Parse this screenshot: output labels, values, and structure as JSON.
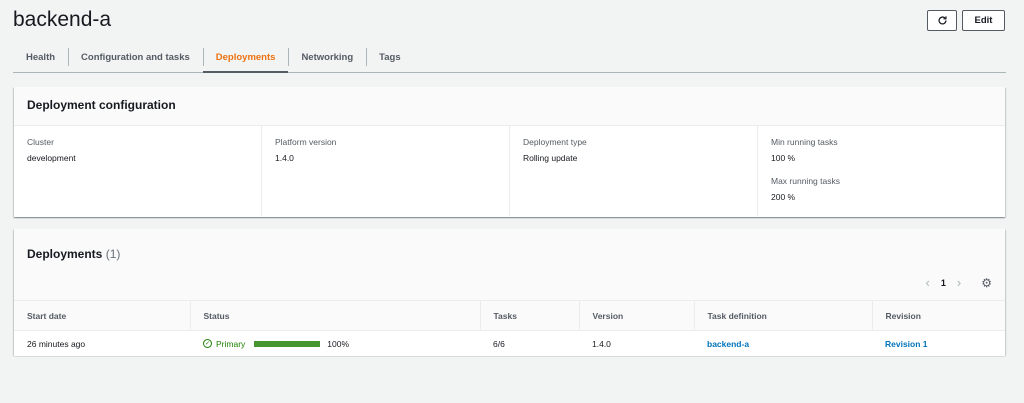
{
  "page": {
    "title": "backend-a",
    "edit_label": "Edit",
    "refresh_icon": "refresh-icon"
  },
  "tabs": [
    {
      "label": "Health",
      "active": false
    },
    {
      "label": "Configuration and tasks",
      "active": false
    },
    {
      "label": "Deployments",
      "active": true
    },
    {
      "label": "Networking",
      "active": false
    },
    {
      "label": "Tags",
      "active": false
    }
  ],
  "deployment_config": {
    "title": "Deployment configuration",
    "cluster": {
      "label": "Cluster",
      "value": "development"
    },
    "platform_version": {
      "label": "Platform version",
      "value": "1.4.0"
    },
    "deployment_type": {
      "label": "Deployment type",
      "value": "Rolling update"
    },
    "min_running": {
      "label": "Min running tasks",
      "value": "100 %"
    },
    "max_running": {
      "label": "Max running tasks",
      "value": "200 %"
    }
  },
  "deployments": {
    "title": "Deployments",
    "count": "(1)",
    "pager": {
      "current_page": "1"
    },
    "columns": [
      "Start date",
      "Status",
      "Tasks",
      "Version",
      "Task definition",
      "Revision"
    ],
    "rows": [
      {
        "start_date": "26 minutes ago",
        "status": "Primary",
        "progress_fraction": 1.0,
        "progress_label": "100%",
        "tasks": "6/6",
        "version": "1.4.0",
        "task_definition": "backend-a",
        "revision": "Revision 1"
      }
    ]
  },
  "colors": {
    "accent_tab": "#ec7211",
    "success": "#1d8102",
    "link": "#0073bb"
  }
}
